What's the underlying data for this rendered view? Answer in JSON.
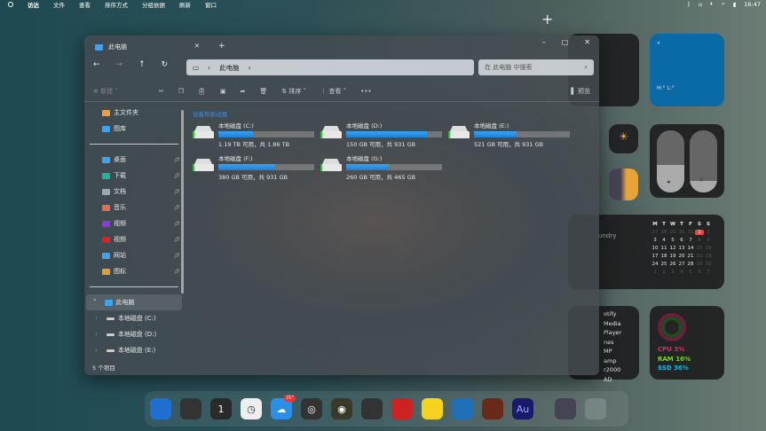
{
  "menubar": {
    "items": [
      "访达",
      "文件",
      "查看",
      "排序方式",
      "分组依据",
      "刷新",
      "窗口"
    ],
    "time": "16:47"
  },
  "window": {
    "tab_title": "此电脑",
    "address": "此电脑",
    "search_placeholder": "在 此电脑 中搜索",
    "toolbar": {
      "new": "新建",
      "sort": "排序",
      "view": "查看",
      "more": "•••",
      "preview": "预览"
    },
    "section_title": "设备和驱动器",
    "drives": [
      {
        "name": "本地磁盘 (C:)",
        "size": "1.19 TB 可用，共 1.86 TB",
        "used_pct": 36
      },
      {
        "name": "本地磁盘 (D:)",
        "size": "150 GB 可用，共 931 GB",
        "used_pct": 84
      },
      {
        "name": "本地磁盘 (E:)",
        "size": "521 GB 可用，共 931 GB",
        "used_pct": 44
      },
      {
        "name": "本地磁盘 (F:)",
        "size": "380 GB 可用，共 931 GB",
        "used_pct": 59
      },
      {
        "name": "本地磁盘 (G:)",
        "size": "260 GB 可用，共 465 GB",
        "used_pct": 44
      }
    ],
    "sidebar": {
      "top": [
        "主文件夹",
        "图库"
      ],
      "pinned": [
        "桌面",
        "下载",
        "文档",
        "音乐",
        "视频",
        "视频",
        "网站",
        "图标"
      ],
      "this_pc": "此电脑",
      "tree": [
        "本地磁盘 (C:)",
        "本地磁盘 (D:)",
        "本地磁盘 (E:)"
      ]
    },
    "status": "5 个项目"
  },
  "widgets": {
    "weather": {
      "temp": "°",
      "hilo": "H:° L:°"
    },
    "music_partial": "undry",
    "players": [
      "otify",
      "Media Player",
      "nes",
      "MP",
      "amp",
      "r2000",
      "AD"
    ],
    "calendar": {
      "days": [
        "M",
        "T",
        "W",
        "T",
        "F",
        "S",
        "S"
      ],
      "today": "1",
      "weeks": [
        [
          "27",
          "28",
          "29",
          "30",
          "31",
          "1",
          "2"
        ],
        [
          "3",
          "4",
          "5",
          "6",
          "7",
          "8",
          "9"
        ],
        [
          "10",
          "11",
          "12",
          "13",
          "14",
          "15",
          "16"
        ],
        [
          "17",
          "18",
          "19",
          "20",
          "21",
          "22",
          "23"
        ],
        [
          "24",
          "25",
          "26",
          "27",
          "28",
          "29",
          "30"
        ],
        [
          "1",
          "2",
          "3",
          "4",
          "5",
          "6",
          "7"
        ]
      ]
    },
    "stats": {
      "cpu": "CPU 3%",
      "ram": "RAM 16%",
      "ssd": "SSD 36%"
    }
  },
  "dock": {
    "apps": [
      "finder",
      "launchpad",
      "calendar",
      "clock",
      "weather",
      "obs",
      "chrome",
      "qq",
      "red-app",
      "notes",
      "video",
      "brave",
      "audition",
      "screen",
      "trash"
    ],
    "calendar_day": "1",
    "weather_badge": "21°",
    "audition_label": "Au"
  }
}
